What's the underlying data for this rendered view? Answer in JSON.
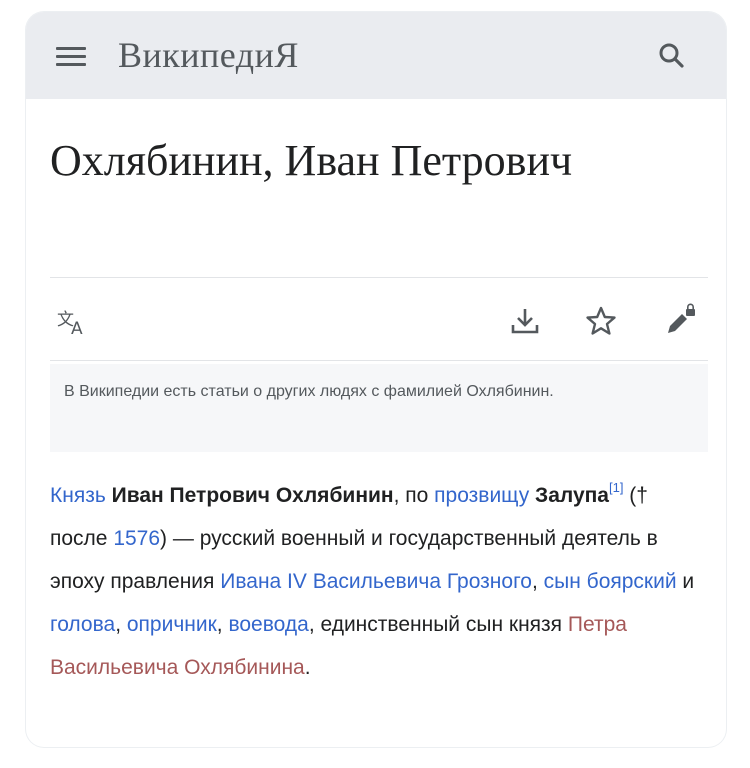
{
  "header": {
    "logo_text": "ВикипедиЯ"
  },
  "article": {
    "title": "Охлябинин, Иван Петрович"
  },
  "toolbar": {
    "icons": [
      "language-icon",
      "download-icon",
      "star-icon",
      "edit-lock-icon"
    ]
  },
  "hatnote": {
    "text": "В Википедии есть статьи о других людях с фамилией Охлябинин."
  },
  "body": {
    "link_knyaz": "Князь",
    "bold_name": "Иван Петрович Охлябинин",
    "text_1": ", по ",
    "link_prozvishchu": "прозвищу",
    "bold_nickname": "Залупа",
    "ref": "[1]",
    "text_2": " († после ",
    "link_year": "1576",
    "text_3": ") — русский военный и государственный деятель в эпоху правления ",
    "link_ivan": "Ивана IV Васильевича Грозного",
    "text_4": ", ",
    "link_syn_boyarsky": "сын боярский",
    "text_5": " и ",
    "link_golova": "голова",
    "text_6": ", ",
    "link_oprichnik": "опричник",
    "text_7": ", ",
    "link_voevoda": "воевода",
    "text_8": ", единственный сын князя ",
    "link_petr": "Петра Васильевича Охлябинина",
    "text_9": "."
  },
  "colors": {
    "link": "#3366cc",
    "visited_link": "#a55858",
    "header_bg": "#eaecf0",
    "text": "#202122"
  }
}
